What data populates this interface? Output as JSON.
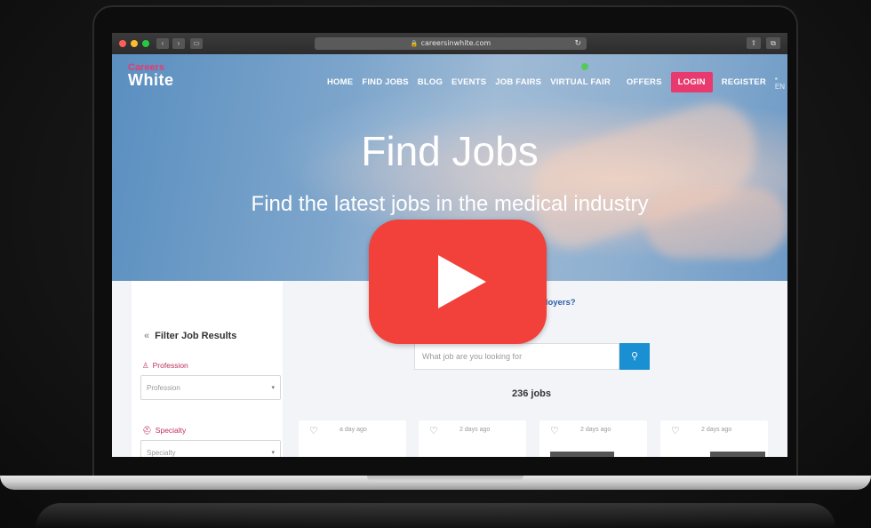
{
  "browser": {
    "url": "careersinwhite.com",
    "back_label": "‹",
    "forward_label": "›",
    "share_label": "⇪",
    "tabs_label": "⧉"
  },
  "site": {
    "logo_top": "Careers",
    "logo_bottom": "White",
    "nav": [
      "HOME",
      "FIND JOBS",
      "BLOG",
      "EVENTS",
      "JOB FAIRS",
      "VIRTUAL FAIR",
      "OFFERS"
    ],
    "login_label": "LOGIN",
    "register_label": "REGISTER",
    "lang_label": "EN",
    "accent": "#e83a6f"
  },
  "hero": {
    "title": "Find Jobs",
    "subtitle": "Find the latest jobs in the medical industry"
  },
  "content": {
    "employers_link": "ployers?",
    "filter_title": "Filter Job Results",
    "profession_label": "Profession",
    "profession_value": "Profession",
    "specialty_label": "Specialty",
    "specialty_value": "Specialty",
    "search_placeholder": "What job are you looking for",
    "jobs_count": "236 jobs",
    "cards": [
      {
        "ago": "a day ago"
      },
      {
        "ago": "2 days ago"
      },
      {
        "ago": "2 days ago"
      },
      {
        "ago": "2 days ago"
      }
    ]
  },
  "video": {
    "play_color": "#f2403a"
  }
}
